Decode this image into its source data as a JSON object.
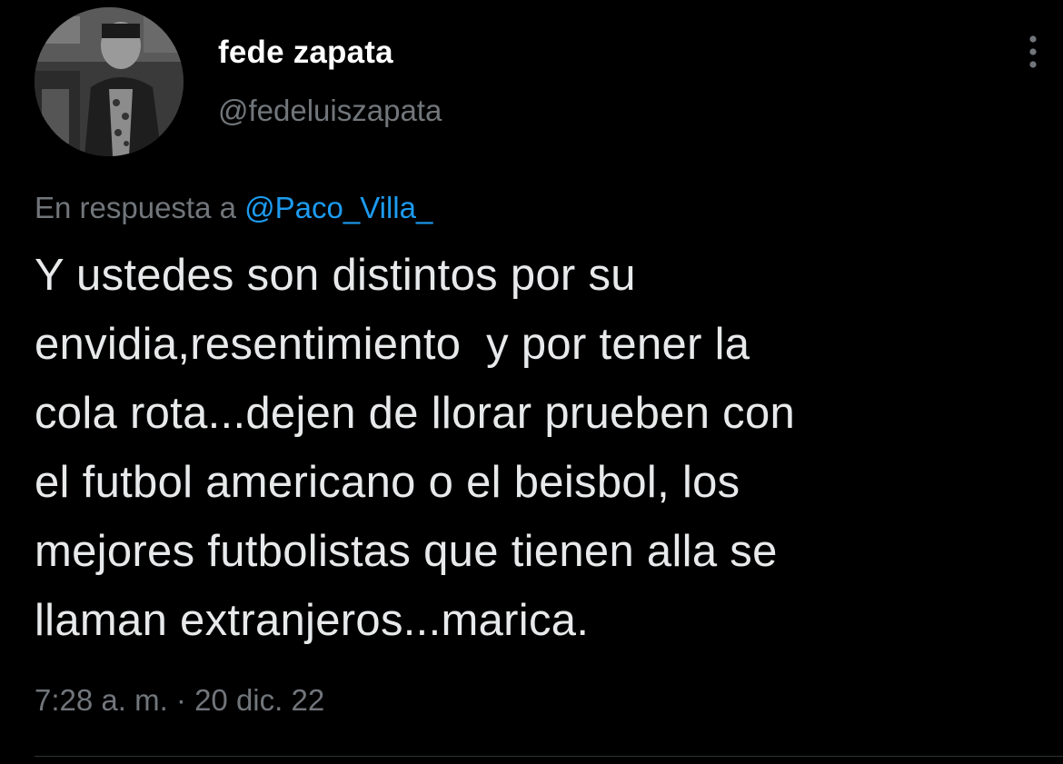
{
  "author": {
    "display_name": "fede zapata",
    "handle": "@fedeluiszapata"
  },
  "reply": {
    "prefix": "En respuesta a",
    "mention": "@Paco_Villa_"
  },
  "tweet": {
    "lines": [
      "Y ustedes son distintos por su",
      "envidia,resentimiento  y por tener la",
      "cola rota...dejen de llorar prueben con",
      "el futbol americano o el beisbol, los",
      "mejores futbolistas que tienen alla se",
      "llaman extranjeros...marica."
    ],
    "timestamp": "7:28 a. m. · 20 dic. 22"
  },
  "icons": {
    "more": "more-vertical-icon",
    "avatar": "profile-photo"
  },
  "colors": {
    "background": "#000000",
    "text": "#e7e9ea",
    "secondary": "#71767b",
    "link": "#1d9bf0"
  }
}
